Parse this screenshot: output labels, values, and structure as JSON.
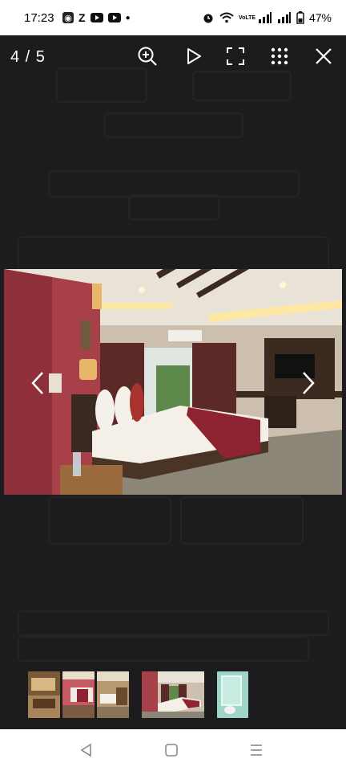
{
  "status_bar": {
    "time": "17:23",
    "apps": [
      "Z"
    ],
    "battery": "47%",
    "network_label": "VoLTE"
  },
  "viewer": {
    "counter": "4 / 5",
    "tools": [
      {
        "name": "zoom-in-icon"
      },
      {
        "name": "play-icon"
      },
      {
        "name": "fullscreen-icon"
      },
      {
        "name": "grid-icon"
      },
      {
        "name": "close-icon"
      }
    ]
  },
  "gallery": {
    "current_index": 4,
    "total": 5
  },
  "navbar": {
    "buttons": [
      "back",
      "home",
      "recents"
    ]
  }
}
